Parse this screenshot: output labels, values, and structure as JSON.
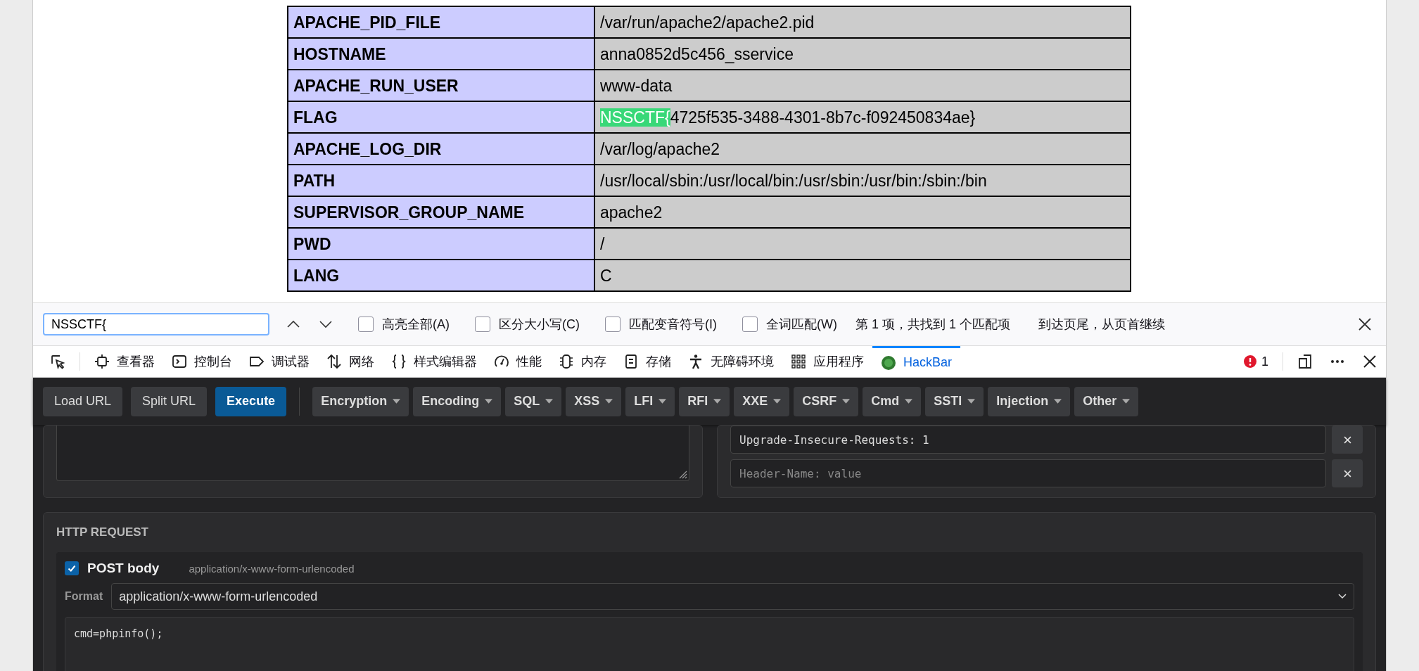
{
  "env_table": {
    "rows": [
      {
        "name": "APACHE_PID_FILE",
        "value": "/var/run/apache2/apache2.pid"
      },
      {
        "name": "HOSTNAME",
        "value": "anna0852d5c456_sservice"
      },
      {
        "name": "APACHE_RUN_USER",
        "value": "www-data"
      },
      {
        "name": "FLAG",
        "match": "NSSCTF{",
        "value": "4725f535-3488-4301-8b7c-f092450834ae}"
      },
      {
        "name": "APACHE_LOG_DIR",
        "value": "/var/log/apache2"
      },
      {
        "name": "PATH",
        "value": "/usr/local/sbin:/usr/local/bin:/usr/sbin:/usr/bin:/sbin:/bin"
      },
      {
        "name": "SUPERVISOR_GROUP_NAME",
        "value": "apache2"
      },
      {
        "name": "PWD",
        "value": "/"
      },
      {
        "name": "LANG",
        "value": "C"
      }
    ]
  },
  "find_bar": {
    "query": "NSSCTF{",
    "options": [
      {
        "label": "高亮全部(A)",
        "checked": false
      },
      {
        "label": "区分大小写(C)",
        "checked": false
      },
      {
        "label": "匹配变音符号(I)",
        "checked": false
      },
      {
        "label": "全词匹配(W)",
        "checked": false
      }
    ],
    "status": "第 1 项，共找到 1 个匹配项",
    "notice": "到达页尾，从页首继续"
  },
  "devtools": {
    "tabs": [
      {
        "label": "查看器",
        "selected": false
      },
      {
        "label": "控制台",
        "selected": false
      },
      {
        "label": "调试器",
        "selected": false
      },
      {
        "label": "网络",
        "selected": false
      },
      {
        "label": "样式编辑器",
        "selected": false
      },
      {
        "label": "性能",
        "selected": false
      },
      {
        "label": "内存",
        "selected": false
      },
      {
        "label": "存储",
        "selected": false
      },
      {
        "label": "无障碍环境",
        "selected": false
      },
      {
        "label": "应用程序",
        "selected": false
      },
      {
        "label": "HackBar",
        "selected": true
      }
    ],
    "error_count": "1"
  },
  "hackbar": {
    "actions": [
      {
        "label": "Load URL",
        "kind": "plain"
      },
      {
        "label": "Split URL",
        "kind": "plain"
      },
      {
        "label": "Execute",
        "kind": "primary"
      }
    ],
    "menus": [
      "Encryption",
      "Encoding",
      "SQL",
      "XSS",
      "LFI",
      "RFI",
      "XXE",
      "CSRF",
      "Cmd",
      "SSTI",
      "Injection",
      "Other"
    ],
    "headers": [
      {
        "value": "Upgrade-Insecure-Requests: 1"
      }
    ],
    "header_placeholder": "Header-Name: value",
    "http_request": {
      "title": "HTTP REQUEST",
      "post_body": {
        "checked": true,
        "label": "POST body",
        "content_type": "application/x-www-form-urlencoded"
      },
      "format_label": "Format",
      "format_value": "application/x-www-form-urlencoded",
      "body": "cmd=phpinfo();"
    }
  }
}
